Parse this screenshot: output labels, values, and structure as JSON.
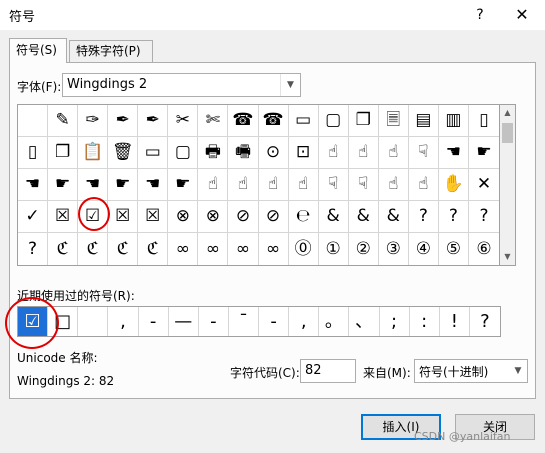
{
  "dialog": {
    "title": "符号",
    "help_icon": "?",
    "close_icon": "✕"
  },
  "tabs": [
    {
      "label": "符号(S)",
      "active": true
    },
    {
      "label": "特殊字符(P)",
      "active": false
    }
  ],
  "font": {
    "label": "字体(F):",
    "value": "Wingdings 2"
  },
  "symbols_grid": [
    [
      "",
      "✎",
      "✑",
      "✒",
      "✒",
      "✂",
      "✄",
      "☎",
      "☎",
      "▭",
      "▢",
      "❐",
      "🗏",
      "▤",
      "▥",
      "▯"
    ],
    [
      "▯",
      "❐",
      "📋",
      "🗑",
      "▭",
      "▢",
      "🖶",
      "🖷",
      "⊙",
      "⊡",
      "☝",
      "☝",
      "☝",
      "☟",
      "☚",
      "☛"
    ],
    [
      "☚",
      "☛",
      "☚",
      "☛",
      "☚",
      "☛",
      "☝",
      "☝",
      "☝",
      "☝",
      "☟",
      "☟",
      "☝",
      "☝",
      "✋",
      "✕"
    ],
    [
      "✓",
      "☒",
      "☑",
      "☒",
      "☒",
      "⊗",
      "⊗",
      "⊘",
      "⊘",
      "℮",
      "&",
      "&",
      "&",
      "?",
      "?",
      "?"
    ],
    [
      "?",
      "ℭ",
      "ℭ",
      "ℭ",
      "ℭ",
      "∞",
      "∞",
      "∞",
      "∞",
      "⓪",
      "①",
      "②",
      "③",
      "④",
      "⑤",
      "⑥"
    ]
  ],
  "recent": {
    "label": "近期使用过的符号(R):",
    "items": [
      "☑",
      "□",
      "",
      ",",
      "-",
      "—",
      "-",
      "¯",
      "-",
      ",",
      "。",
      "、",
      ";",
      ":",
      "!",
      "?"
    ]
  },
  "unicode_name": {
    "label": "Unicode 名称:",
    "value": "Wingdings 2: 82"
  },
  "char_code": {
    "label": "字符代码(C):",
    "value": "82"
  },
  "from": {
    "label": "来自(M):",
    "value": "符号(十进制)"
  },
  "buttons": {
    "insert": "插入(I)",
    "close": "关闭"
  },
  "watermark": "CSDN @yanlaifan",
  "colors": {
    "highlight": "#1e6fd8",
    "annotation": "#e00000",
    "focus": "#0078d7"
  }
}
